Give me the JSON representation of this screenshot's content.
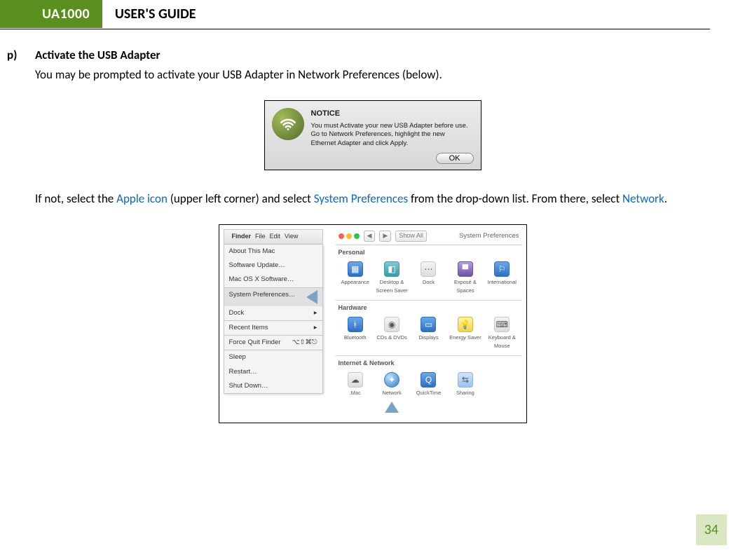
{
  "header": {
    "badge": "UA1000",
    "title": "USER'S GUIDE"
  },
  "step": {
    "marker": "p)",
    "title": "Activate the USB Adapter",
    "intro": "You may be prompted to activate your USB Adapter in Network Preferences (below).",
    "para2_a": "If not, select the ",
    "para2_link1": "Apple icon",
    "para2_b": " (upper left corner) and select ",
    "para2_link2": "System Preferences",
    "para2_c": " from the drop-down list. From there, select ",
    "para2_link3": "Network",
    "para2_d": "."
  },
  "notice": {
    "title": "NOTICE",
    "line1": "You must Activate your new USB Adapter before use.",
    "line2": "Go to Network Preferences, highlight the new",
    "line3": "Ethernet Adapter and click Apply.",
    "ok": "OK"
  },
  "menubar": {
    "finder": "Finder",
    "file": "File",
    "edit": "Edit",
    "view": "View"
  },
  "appleMenu": {
    "about": "About This Mac",
    "swupdate": "Software Update…",
    "macosx": "Mac OS X Software…",
    "sysprefs": "System Preferences…",
    "dock": "Dock",
    "recent": "Recent Items",
    "forcequit": "Force Quit Finder",
    "forcequit_sc": "⌥⇧⌘⎋",
    "sleep": "Sleep",
    "restart": "Restart…",
    "shutdown": "Shut Down…"
  },
  "sysprefs": {
    "showall": "Show All",
    "title": "System Preferences",
    "sections": {
      "personal": "Personal",
      "hardware": "Hardware",
      "internet": "Internet & Network"
    },
    "personal": [
      "Appearance",
      "Desktop & Screen Saver",
      "Dock",
      "Exposé & Spaces",
      "International"
    ],
    "hardware": [
      "Bluetooth",
      "CDs & DVDs",
      "Displays",
      "Energy Saver",
      "Keyboard & Mouse"
    ],
    "internet": [
      ".Mac",
      "Network",
      "QuickTime",
      "Sharing"
    ]
  },
  "page": "34"
}
